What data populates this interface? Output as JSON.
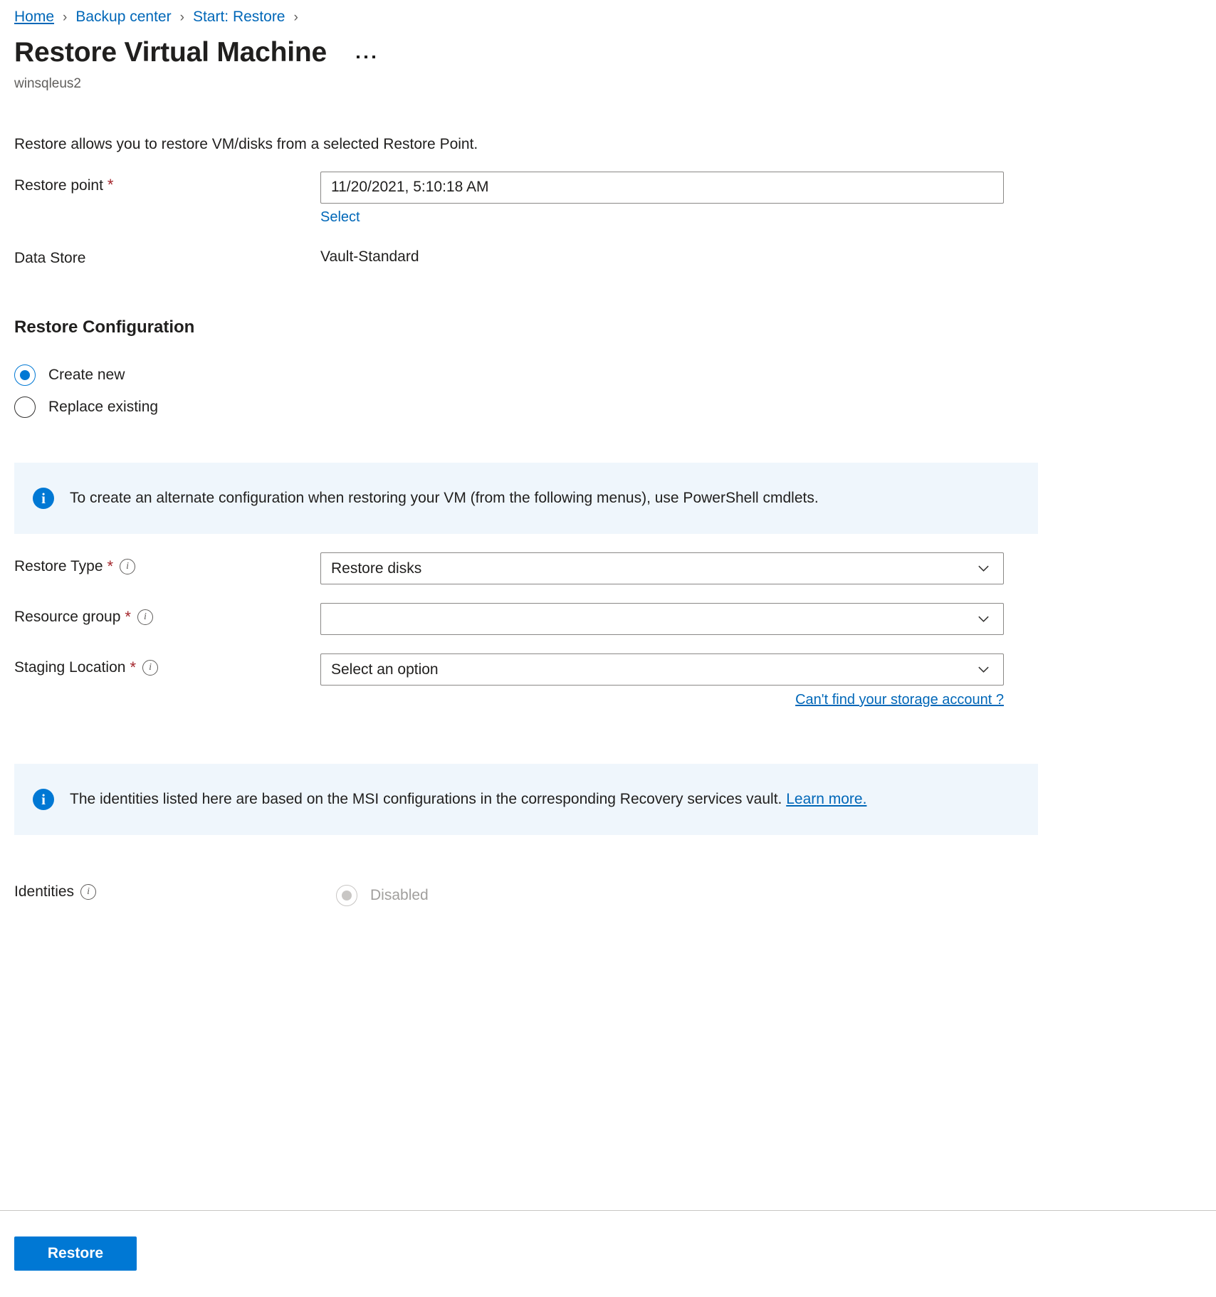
{
  "breadcrumb": {
    "items": [
      {
        "label": "Home"
      },
      {
        "label": "Backup center"
      },
      {
        "label": "Start: Restore"
      }
    ],
    "separator": "›"
  },
  "header": {
    "title": "Restore Virtual Machine",
    "subtitle": "winsqleus2",
    "more_options_label": "..."
  },
  "intro": "Restore allows you to restore VM/disks from a selected Restore Point.",
  "restore_point": {
    "label": "Restore point",
    "required": "*",
    "value": "11/20/2021, 5:10:18 AM",
    "select_link": "Select"
  },
  "data_store": {
    "label": "Data Store",
    "value": "Vault-Standard"
  },
  "restore_configuration": {
    "title": "Restore Configuration",
    "options": [
      {
        "label": "Create new",
        "selected": true
      },
      {
        "label": "Replace existing",
        "selected": false
      }
    ]
  },
  "banner_powershell": {
    "icon": "info-icon",
    "text": "To create an alternate configuration when restoring your VM (from the following menus), use PowerShell cmdlets."
  },
  "fields": {
    "restore_type": {
      "label": "Restore Type",
      "required": "*",
      "value": "Restore disks"
    },
    "resource_group": {
      "label": "Resource group",
      "required": "*",
      "value": ""
    },
    "staging_location": {
      "label": "Staging Location",
      "required": "*",
      "value": "Select an option",
      "help_link": "Can't find your storage account ?"
    }
  },
  "banner_identities": {
    "icon": "info-icon",
    "text": "The identities listed here are based on the MSI configurations in the corresponding Recovery services vault.",
    "link": "Learn more."
  },
  "identities": {
    "label": "Identities",
    "option_label": "Disabled",
    "disabled": true
  },
  "footer": {
    "restore_button": "Restore"
  },
  "colors": {
    "accent": "#0078d4",
    "link": "#0067b8",
    "required_asterisk": "#a4262c",
    "banner_background": "#eff6fc",
    "border": "#8a8886"
  }
}
